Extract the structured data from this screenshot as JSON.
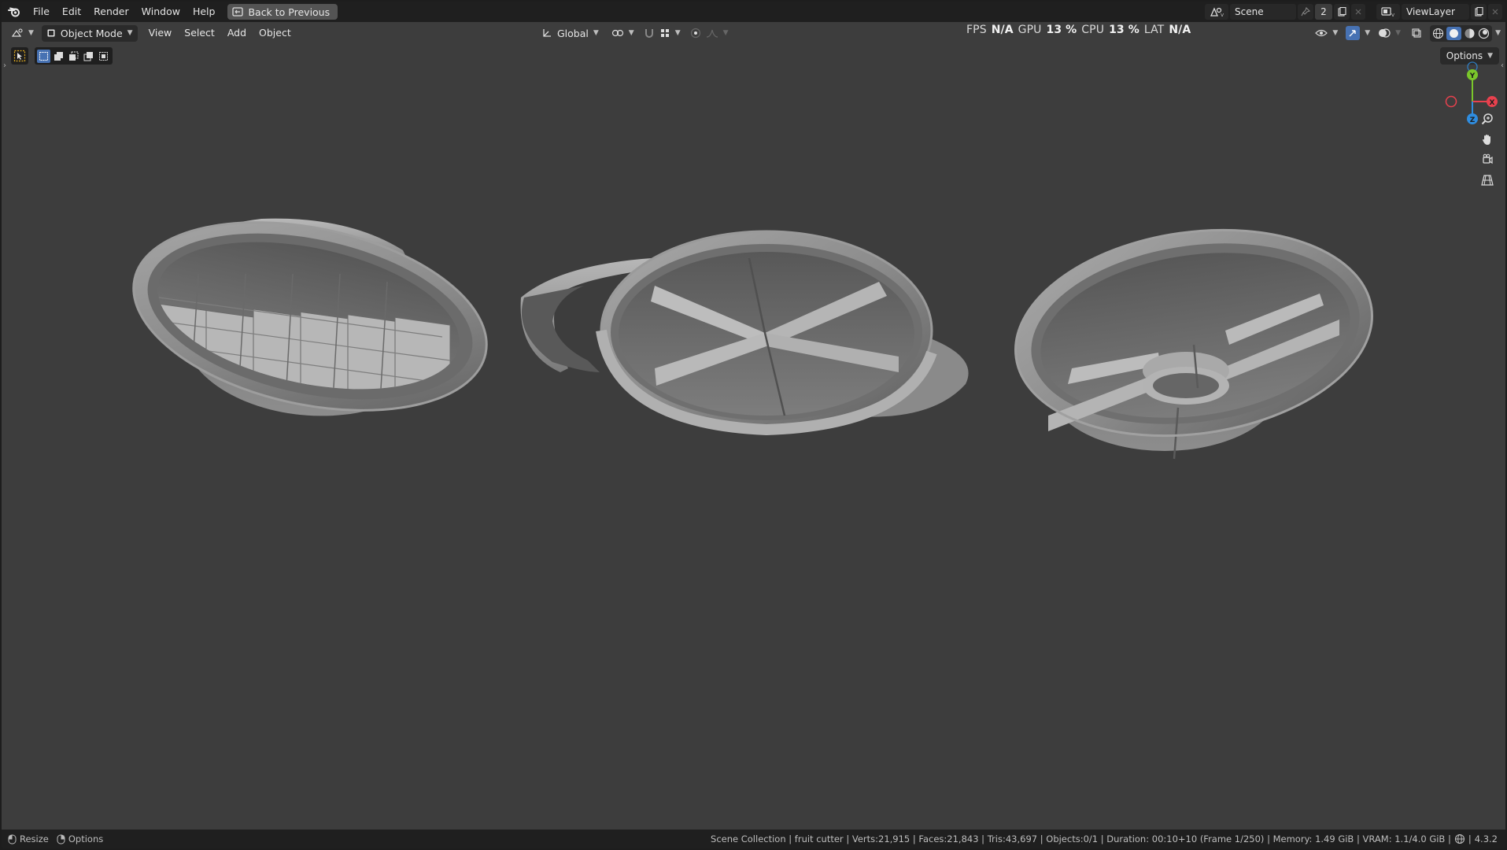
{
  "topbar": {
    "menus": [
      "File",
      "Edit",
      "Render",
      "Window",
      "Help"
    ],
    "back_button": "Back to Previous",
    "scene_name": "Scene",
    "scene_users": "2",
    "view_layer": "ViewLayer"
  },
  "viewport_header": {
    "mode": "Object Mode",
    "menus": [
      "View",
      "Select",
      "Add",
      "Object"
    ],
    "orientation": "Global",
    "options_label": "Options"
  },
  "stats": {
    "fps_label": "FPS",
    "fps_value": "N/A",
    "gpu_label": "GPU",
    "gpu_value": "13 %",
    "cpu_label": "CPU",
    "cpu_value": "13 %",
    "lat_label": "LAT",
    "lat_value": "N/A"
  },
  "gizmo": {
    "x": "X",
    "y": "Y",
    "z": "Z"
  },
  "statusbar": {
    "left": [
      "Resize",
      "Options"
    ],
    "info": "Scene Collection | fruit cutter | Verts:21,915 | Faces:21,843 | Tris:43,697 | Objects:0/1 | Duration: 00:10+10 (Frame 1/250) | Memory: 1.49 GiB | VRAM: 1.1/4.0 GiB |",
    "version": "4.3.2"
  },
  "colors": {
    "viewport_bg": "#3d3d3d",
    "header_bg": "#1f1f1f",
    "accent_blue": "#4772b3",
    "axis_x": "#e8414e",
    "axis_y": "#7ac72b",
    "axis_z": "#2f8de0"
  }
}
